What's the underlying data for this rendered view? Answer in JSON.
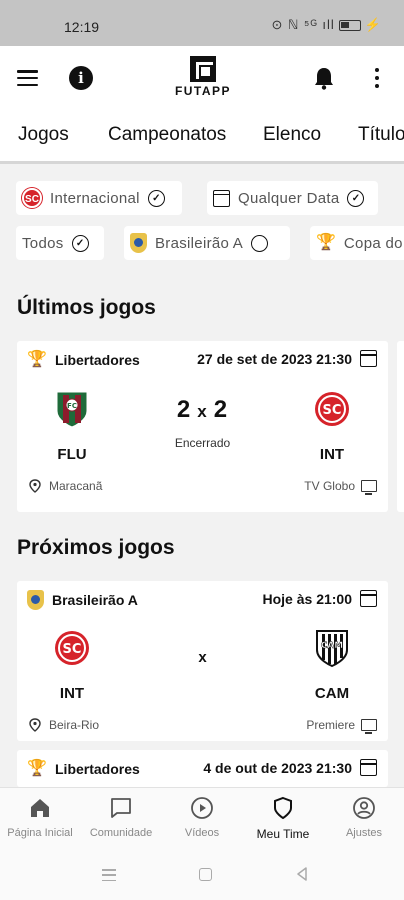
{
  "status_bar": {
    "time": "12:19",
    "system_icons": "⊙ ℕ ⁵ᴳ ıll"
  },
  "app_bar": {
    "logo_text": "FUTAPP",
    "icons": [
      "menu-icon",
      "info-icon",
      "bell-icon",
      "more-vert-icon"
    ]
  },
  "tabs": [
    {
      "label": "Jogos",
      "active": true
    },
    {
      "label": "Campeonatos"
    },
    {
      "label": "Elenco"
    },
    {
      "label": "Títulos"
    }
  ],
  "filters": {
    "row1": [
      {
        "label": "Internacional",
        "icon": "internacional-crest",
        "state": "checked"
      },
      {
        "label": "Qualquer Data",
        "icon": "calendar-icon",
        "state": "checked"
      }
    ],
    "row2": [
      {
        "label": "Todos",
        "state": "checked"
      },
      {
        "label": "Brasileirão A",
        "icon": "brasileirao-icon",
        "state": "unchecked"
      },
      {
        "label": "Copa do Brasil",
        "icon": "cup-icon",
        "state": "unchecked"
      }
    ]
  },
  "sections": {
    "past_title": "Últimos jogos",
    "upcoming_title": "Próximos jogos"
  },
  "past_match": {
    "competition": "Libertadores",
    "datetime": "27 de set de 2023 21:30",
    "home": "FLU",
    "away": "INT",
    "home_score": "2",
    "away_score": "2",
    "separator": "x",
    "status": "Encerrado",
    "venue": "Maracanã",
    "broadcast": "TV Globo"
  },
  "next_match": {
    "competition": "Brasileirão A",
    "datetime": "Hoje às 21:00",
    "home": "INT",
    "away": "CAM",
    "separator": "x",
    "venue": "Beira-Rio",
    "broadcast": "Premiere"
  },
  "third_match": {
    "competition": "Libertadores",
    "datetime": "4 de out de 2023 21:30"
  },
  "bottom_nav": [
    {
      "label": "Página Inicial",
      "icon": "home-icon"
    },
    {
      "label": "Comunidade",
      "icon": "chat-icon"
    },
    {
      "label": "Vídeos",
      "icon": "play-icon"
    },
    {
      "label": "Meu Time",
      "icon": "shield-icon",
      "active": true
    },
    {
      "label": "Ajustes",
      "icon": "account-icon"
    }
  ],
  "colors": {
    "inter_red": "#d6232a",
    "flu_green": "#1f6b3a",
    "flu_maroon": "#8c1c2c",
    "trophy_gold": "#c59a28"
  }
}
